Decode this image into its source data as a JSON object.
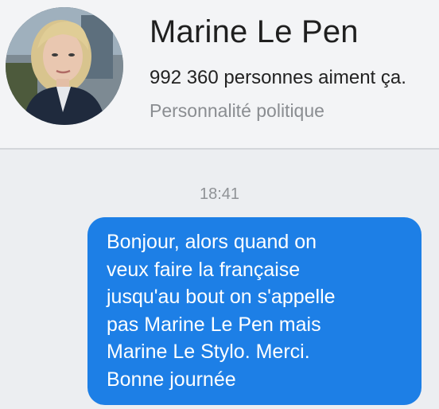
{
  "page": {
    "name": "Marine Le Pen",
    "likes": "992 360 personnes aiment ça.",
    "category": "Personnalité politique"
  },
  "conversation": {
    "timestamp": "18:41",
    "message_lines": [
      "Bonjour, alors quand on",
      "veux faire la française",
      "jusqu'au bout on s'appelle",
      "pas Marine Le Pen mais",
      "Marine Le Stylo. Merci.",
      "Bonne journée"
    ]
  },
  "colors": {
    "bubble": "#1d7fe6",
    "header_background": "#f3f4f6",
    "chat_background": "#eceef1",
    "secondary_text": "#8a8d91"
  }
}
